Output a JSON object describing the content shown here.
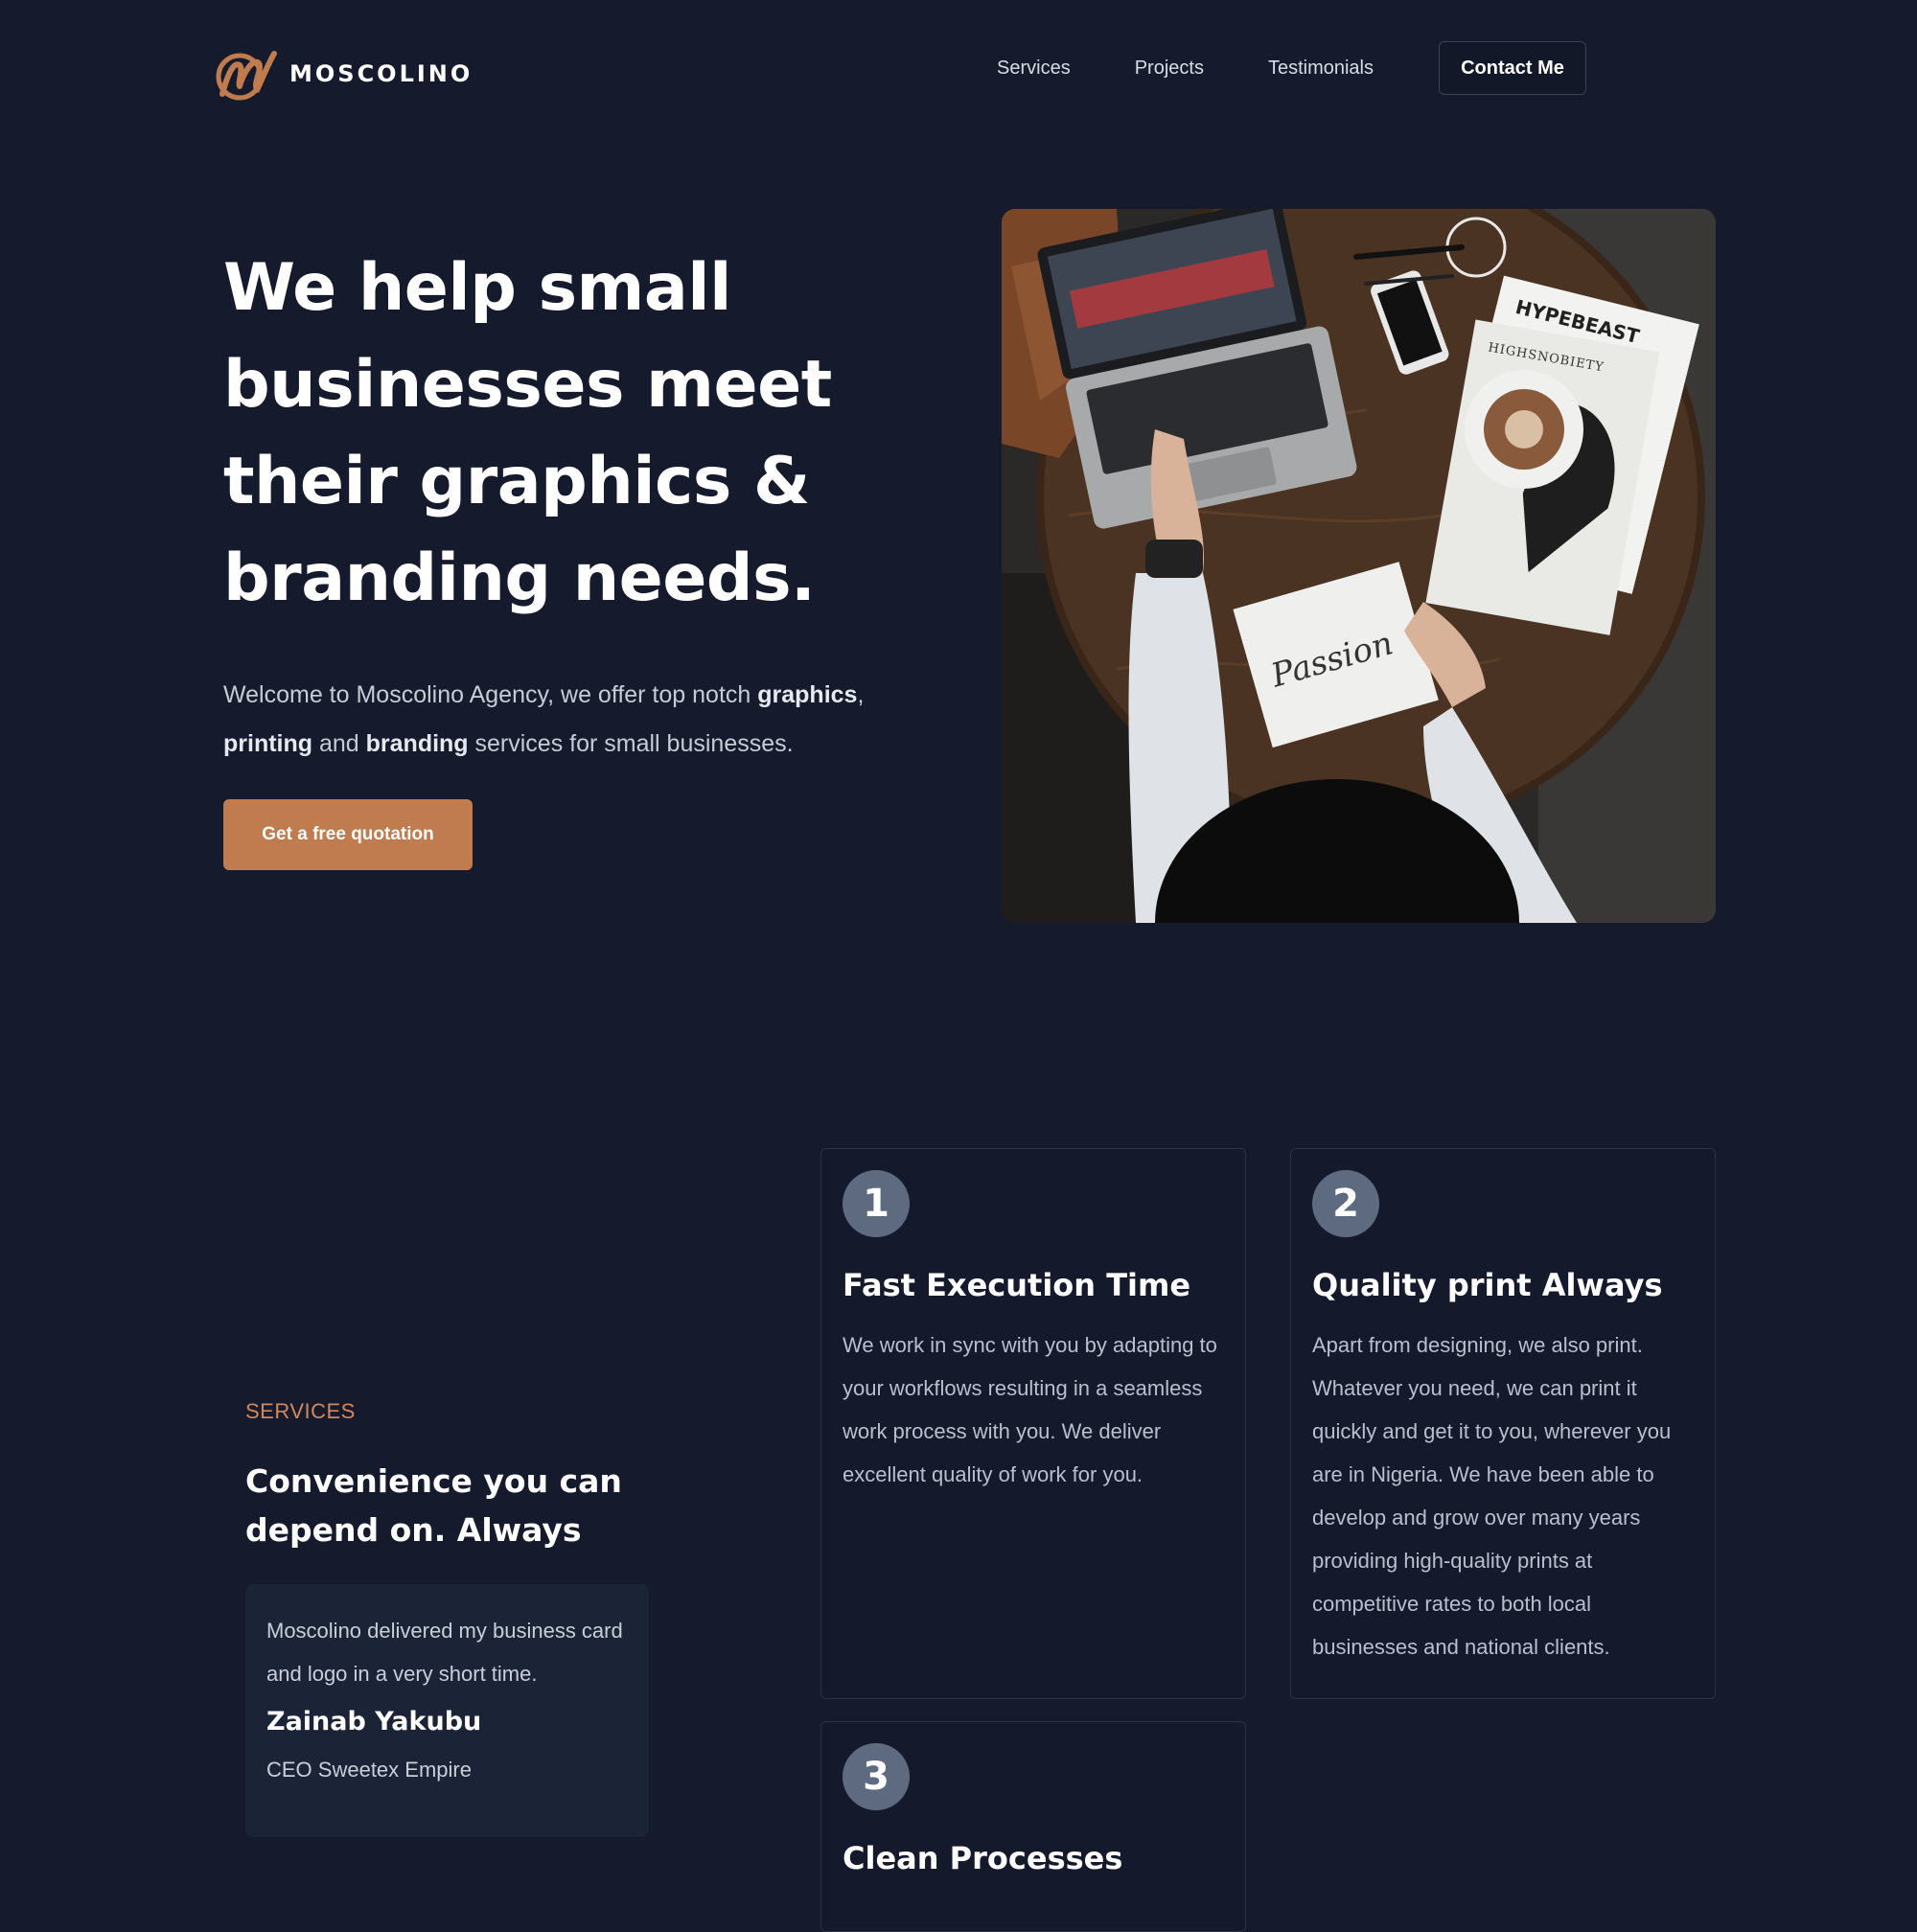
{
  "brand": {
    "name": "MOSCOLINO",
    "accent_color": "#c07b4f",
    "background_color": "#151b2c"
  },
  "nav": {
    "items": [
      "Services",
      "Projects",
      "Testimonials"
    ],
    "contact_label": "Contact Me"
  },
  "hero": {
    "title": "We help small businesses meet their graphics & branding needs.",
    "subtitle_parts": {
      "p1": "Welcome to Moscolino Agency, we offer top notch ",
      "b1": "graphics",
      "p2": ", ",
      "b2": "printing",
      "p3": " and ",
      "b3": "branding",
      "p4": " services for small businesses."
    },
    "cta_label": "Get a free quotation",
    "image_magazine_text_1": "HYPEBEAST",
    "image_magazine_text_2": "HIGHSNOBIETY",
    "image_sketch_text": "Passion"
  },
  "services": {
    "eyebrow": "SERVICES",
    "heading": "Convenience you can depend on. Always",
    "testimonial": {
      "quote": "Moscolino delivered my business card and logo in a very short time.",
      "name": "Zainab Yakubu",
      "role": "CEO Sweetex Empire"
    },
    "features": [
      {
        "number": "1",
        "title": "Fast Execution Time",
        "body": "We work in sync with you by adapting to your workflows resulting in a seamless work process with you. We deliver excellent quality of work for you."
      },
      {
        "number": "2",
        "title": "Quality print Always",
        "body": "Apart from designing, we also print. Whatever you need, we can print it quickly and get it to you, wherever you are in Nigeria. We have been able to develop and grow over many years providing high-quality prints at competitive rates to both local businesses and national clients."
      },
      {
        "number": "3",
        "title": "Clean Processes",
        "body": ""
      }
    ]
  }
}
